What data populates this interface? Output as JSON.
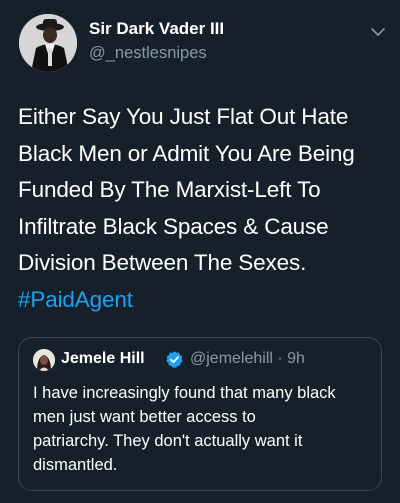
{
  "tweet": {
    "author": {
      "name": "Sir Dark Vader III",
      "handle": "@_nestlesnipes"
    },
    "text_lines": [
      "Either Say You Just Flat Out Hate",
      "Black Men or Admit You Are Being",
      "Funded By The Marxist-Left To",
      "Infiltrate Black Spaces & Cause",
      "Division Between The Sexes."
    ],
    "hashtag": "#PaidAgent",
    "menu_icon": "chevron-down-icon"
  },
  "quoted_tweet": {
    "author_name": "Jemele Hill",
    "verified": true,
    "meta": "@jemelehill · 9h",
    "text_lines": [
      "I have increasingly found that many black",
      "men just want better access to",
      "patriarchy. They don't actually want it",
      "dismantled."
    ]
  },
  "colors": {
    "background": "#15202b",
    "text": "#ffffff",
    "secondary_text": "#8899a6",
    "hashtag": "#1da1f2",
    "border": "#38444d",
    "verified": "#1da1f2"
  }
}
